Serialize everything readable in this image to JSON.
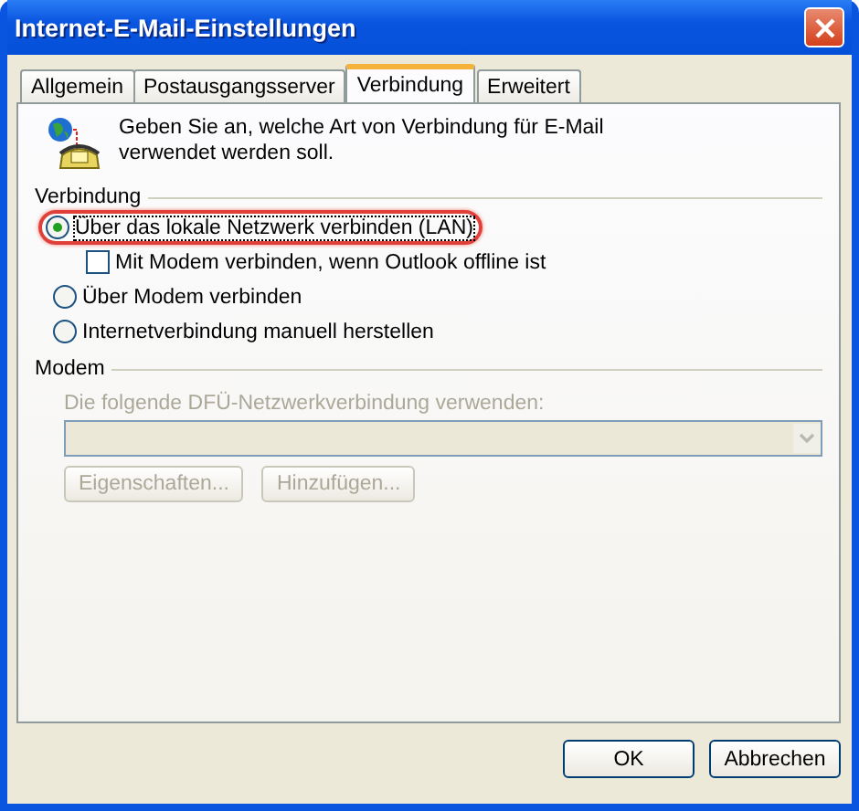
{
  "window": {
    "title": "Internet-E-Mail-Einstellungen"
  },
  "tabs": [
    {
      "label": "Allgemein",
      "selected": false
    },
    {
      "label": "Postausgangsserver",
      "selected": false
    },
    {
      "label": "Verbindung",
      "selected": true
    },
    {
      "label": "Erweitert",
      "selected": false
    }
  ],
  "intro": "Geben Sie an, welche Art von Verbindung für E-Mail verwendet werden soll.",
  "connection": {
    "title": "Verbindung",
    "options": [
      {
        "kind": "radio",
        "label": "Über das lokale Netzwerk verbinden (LAN)",
        "selected": true,
        "highlighted": true
      },
      {
        "kind": "checkbox",
        "label": "Mit Modem verbinden, wenn Outlook offline ist",
        "checked": false,
        "highlighted": false
      },
      {
        "kind": "radio",
        "label": "Über Modem verbinden",
        "selected": false,
        "highlighted": false
      },
      {
        "kind": "radio",
        "label": "Internetverbindung manuell herstellen",
        "selected": false,
        "highlighted": false
      }
    ]
  },
  "modem": {
    "title": "Modem",
    "disabled": true,
    "label": "Die folgende DFÜ-Netzwerkverbindung verwenden:",
    "buttons": [
      "Eigenschaften...",
      "Hinzufügen..."
    ]
  },
  "buttons": [
    "OK",
    "Abbrechen"
  ]
}
